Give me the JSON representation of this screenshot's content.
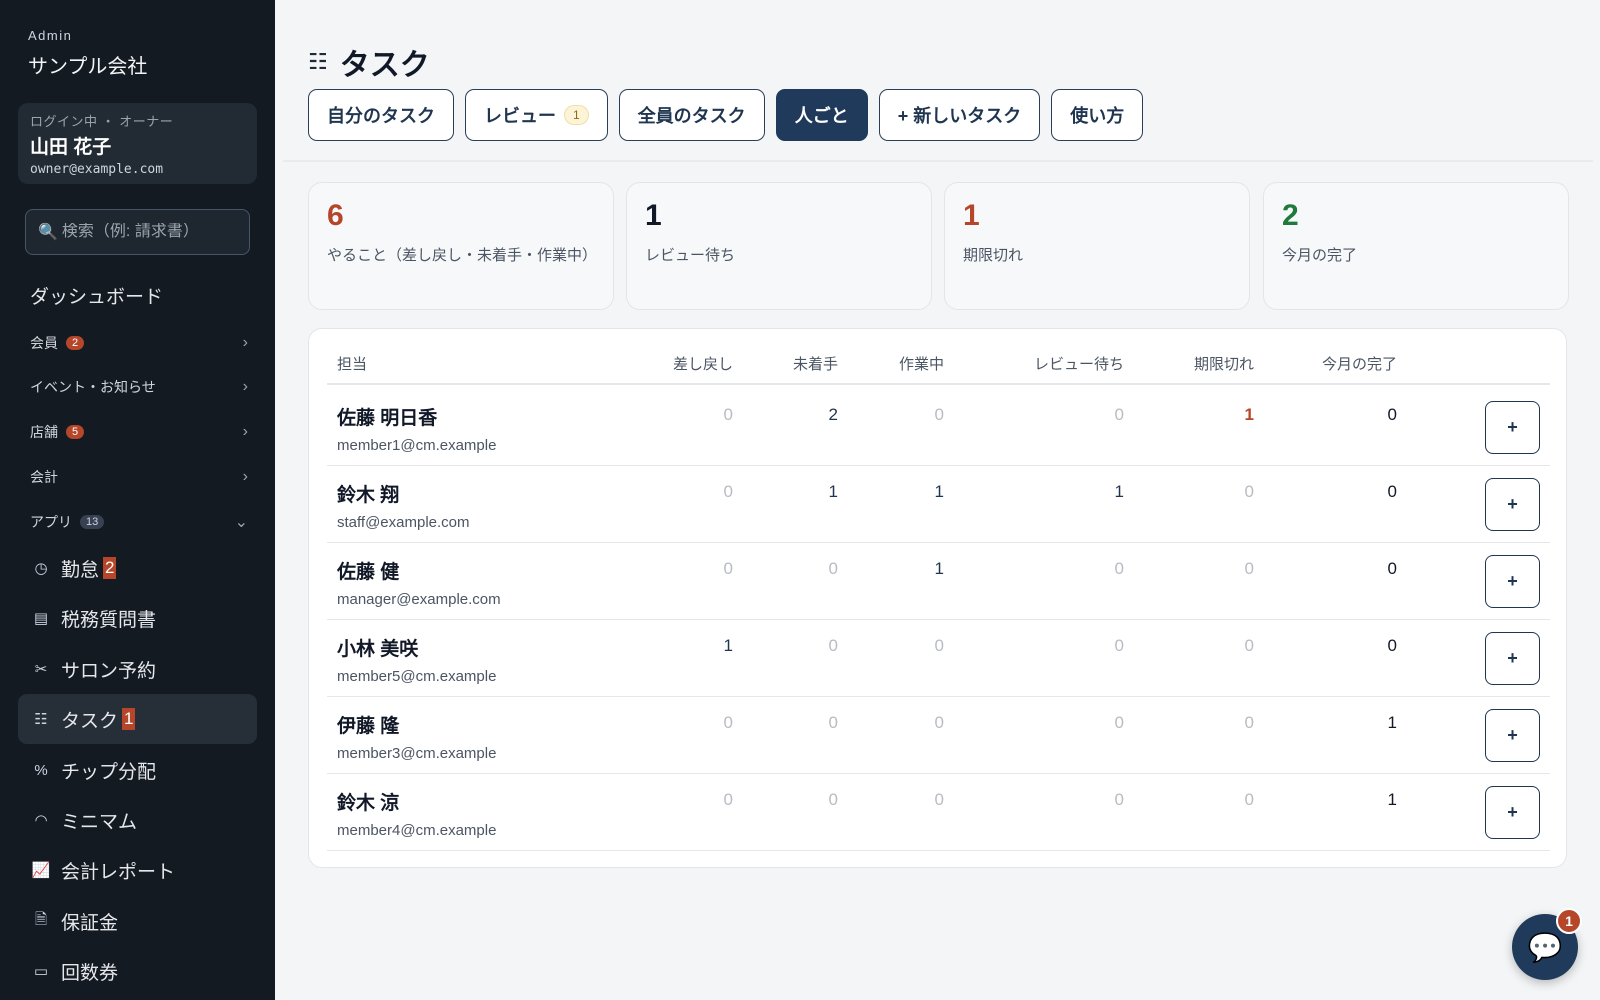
{
  "sidebar": {
    "brand_small": "Admin",
    "brand_name": "サンプル会社",
    "user": {
      "role": "ログイン中 ・ オーナー",
      "name": "山田 花子",
      "email": "owner@example.com"
    },
    "search": {
      "icon": "🔍",
      "placeholder": "検索（例: 請求書）"
    },
    "dashboard": "ダッシュボード",
    "sections": [
      {
        "label": "会員",
        "count": "2",
        "chevron": "›"
      },
      {
        "label": "イベント・お知らせ",
        "count": "",
        "chevron": "›"
      },
      {
        "label": "店舗",
        "count": "5",
        "chevron": "›"
      },
      {
        "label": "会計",
        "count": "",
        "chevron": "›"
      },
      {
        "label": "アプリ",
        "count": "13",
        "chevron": "⌄"
      }
    ],
    "apps": [
      {
        "label": "勤怠",
        "badge": "2",
        "icon": "◷"
      },
      {
        "label": "税務質問書",
        "badge": "",
        "icon": "▤"
      },
      {
        "label": "サロン予約",
        "badge": "",
        "icon": "✂"
      },
      {
        "label": "タスク",
        "badge": "1",
        "icon": "☷"
      },
      {
        "label": "チップ分配",
        "badge": "",
        "icon": "%"
      },
      {
        "label": "ミニマム",
        "badge": "",
        "icon": "◠"
      },
      {
        "label": "会計レポート",
        "badge": "",
        "icon": "📈"
      },
      {
        "label": "保証金",
        "badge": "",
        "icon": "🗎"
      },
      {
        "label": "回数券",
        "badge": "",
        "icon": "▭"
      }
    ]
  },
  "header": {
    "title": "タスク",
    "title_icon": "☷",
    "tabs": [
      {
        "label": "自分のタスク",
        "badge": ""
      },
      {
        "label": "レビュー",
        "badge": "1"
      },
      {
        "label": "全員のタスク",
        "badge": ""
      },
      {
        "label": "人ごと",
        "badge": "",
        "active": true
      },
      {
        "label": "+ 新しいタスク",
        "badge": ""
      },
      {
        "label": "使い方",
        "badge": ""
      }
    ]
  },
  "stats": [
    {
      "value": "6",
      "label": "やること（差し戻し・未着手・作業中）",
      "color": "#b5462a"
    },
    {
      "value": "1",
      "label": "レビュー待ち",
      "color": "#111827"
    },
    {
      "value": "1",
      "label": "期限切れ",
      "color": "#b5462a"
    },
    {
      "value": "2",
      "label": "今月の完了",
      "color": "#1f7a3c"
    }
  ],
  "table": {
    "columns": [
      "担当",
      "差し戻し",
      "未着手",
      "作業中",
      "レビュー待ち",
      "期限切れ",
      "今月の完了"
    ],
    "add_label": "+",
    "rows": [
      {
        "name": "佐藤 明日香",
        "email": "member1@cm.example",
        "values": [
          "0",
          "2",
          "0",
          "0",
          "1",
          "0"
        ]
      },
      {
        "name": "鈴木 翔",
        "email": "staff@example.com",
        "values": [
          "0",
          "1",
          "1",
          "1",
          "0",
          "0"
        ]
      },
      {
        "name": "佐藤 健",
        "email": "manager@example.com",
        "values": [
          "0",
          "0",
          "1",
          "0",
          "0",
          "0"
        ]
      },
      {
        "name": "小林 美咲",
        "email": "member5@cm.example",
        "values": [
          "1",
          "0",
          "0",
          "0",
          "0",
          "0"
        ]
      },
      {
        "name": "伊藤 隆",
        "email": "member3@cm.example",
        "values": [
          "0",
          "0",
          "0",
          "0",
          "0",
          "1"
        ]
      },
      {
        "name": "鈴木 涼",
        "email": "member4@cm.example",
        "values": [
          "0",
          "0",
          "0",
          "0",
          "0",
          "1"
        ]
      }
    ]
  },
  "chat": {
    "icon": "💬",
    "badge": "1"
  }
}
